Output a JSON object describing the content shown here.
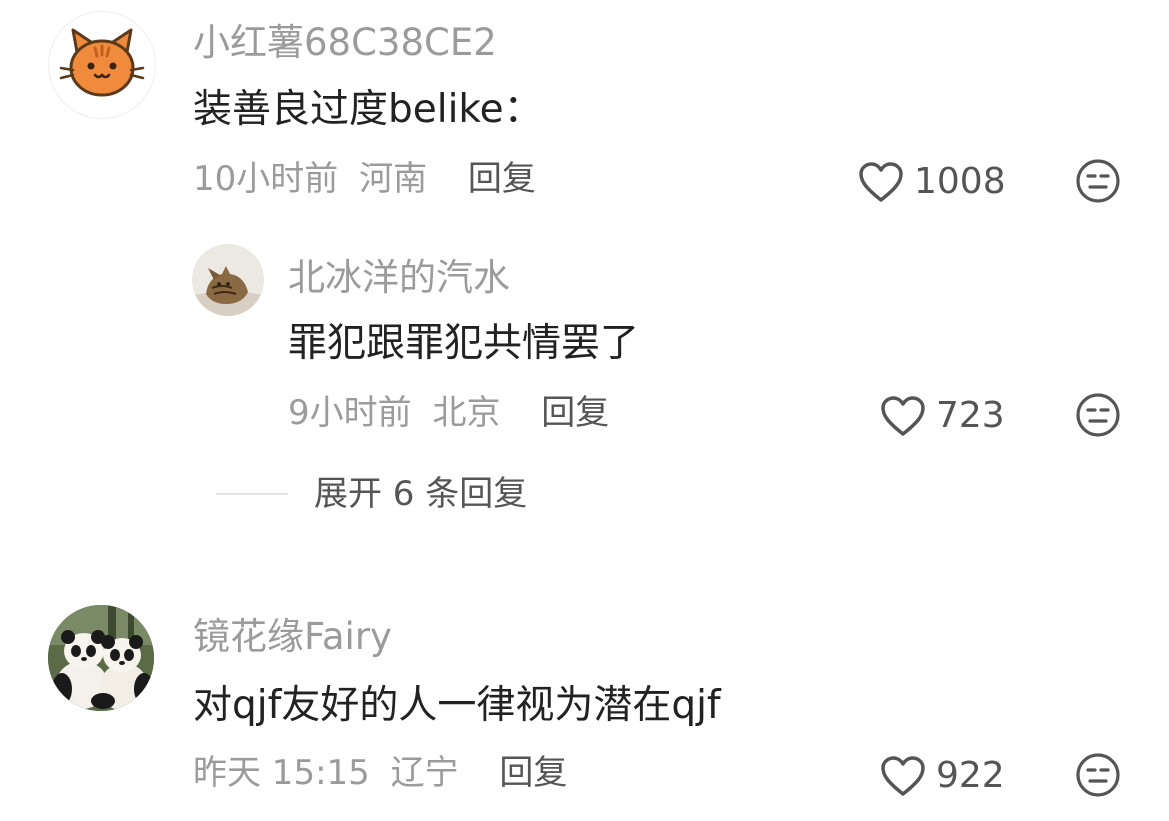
{
  "comments": [
    {
      "username": "小红薯68C38CE2",
      "content": "装善良过度belike：",
      "time": "10小时前",
      "location": "河南",
      "reply_label": "回复",
      "likes": "1008",
      "replies": [
        {
          "username": "北冰洋的汽水",
          "content": "罪犯跟罪犯共情罢了",
          "time": "9小时前",
          "location": "北京",
          "reply_label": "回复",
          "likes": "723"
        }
      ],
      "expand_label": "展开 6 条回复"
    },
    {
      "username": "镜花缘Fairy",
      "content": "对qjf友好的人一律视为潜在qjf",
      "time": "昨天 15:15",
      "location": "辽宁",
      "reply_label": "回复",
      "likes": "922"
    }
  ],
  "colors": {
    "username": "#9b9b9b",
    "content": "#222222",
    "meta": "#9b9b9b",
    "action": "#555555",
    "cat_orange": "#f08a3c"
  },
  "icons": {
    "like": "heart-outline-icon",
    "react": "neutral-face-icon"
  }
}
